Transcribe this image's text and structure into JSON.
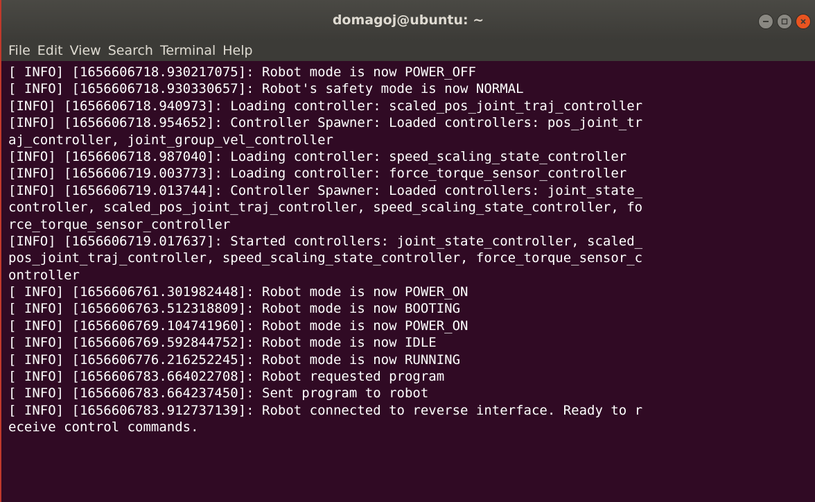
{
  "window": {
    "title": "domagoj@ubuntu: ~",
    "controls": {
      "minimize_icon": "minimize-icon",
      "maximize_icon": "maximize-icon",
      "close_icon": "close-icon"
    }
  },
  "menu": {
    "items": [
      "File",
      "Edit",
      "View",
      "Search",
      "Terminal",
      "Help"
    ]
  },
  "terminal": {
    "lines": [
      "[ INFO] [1656606718.930217075]: Robot mode is now POWER_OFF",
      "[ INFO] [1656606718.930330657]: Robot's safety mode is now NORMAL",
      "[INFO] [1656606718.940973]: Loading controller: scaled_pos_joint_traj_controller",
      "[INFO] [1656606718.954652]: Controller Spawner: Loaded controllers: pos_joint_tr",
      "aj_controller, joint_group_vel_controller",
      "[INFO] [1656606718.987040]: Loading controller: speed_scaling_state_controller",
      "[INFO] [1656606719.003773]: Loading controller: force_torque_sensor_controller",
      "[INFO] [1656606719.013744]: Controller Spawner: Loaded controllers: joint_state_",
      "controller, scaled_pos_joint_traj_controller, speed_scaling_state_controller, fo",
      "rce_torque_sensor_controller",
      "[INFO] [1656606719.017637]: Started controllers: joint_state_controller, scaled_",
      "pos_joint_traj_controller, speed_scaling_state_controller, force_torque_sensor_c",
      "ontroller",
      "[ INFO] [1656606761.301982448]: Robot mode is now POWER_ON",
      "[ INFO] [1656606763.512318809]: Robot mode is now BOOTING",
      "[ INFO] [1656606769.104741960]: Robot mode is now POWER_ON",
      "[ INFO] [1656606769.592844752]: Robot mode is now IDLE",
      "[ INFO] [1656606776.216252245]: Robot mode is now RUNNING",
      "[ INFO] [1656606783.664022708]: Robot requested program",
      "[ INFO] [1656606783.664237450]: Sent program to robot",
      "[ INFO] [1656606783.912737139]: Robot connected to reverse interface. Ready to r",
      "eceive control commands."
    ]
  },
  "colors": {
    "terminal_bg": "#300a24",
    "titlebar_bg": "#3c3b37",
    "text": "#ffffff",
    "close_button": "#e95420"
  }
}
